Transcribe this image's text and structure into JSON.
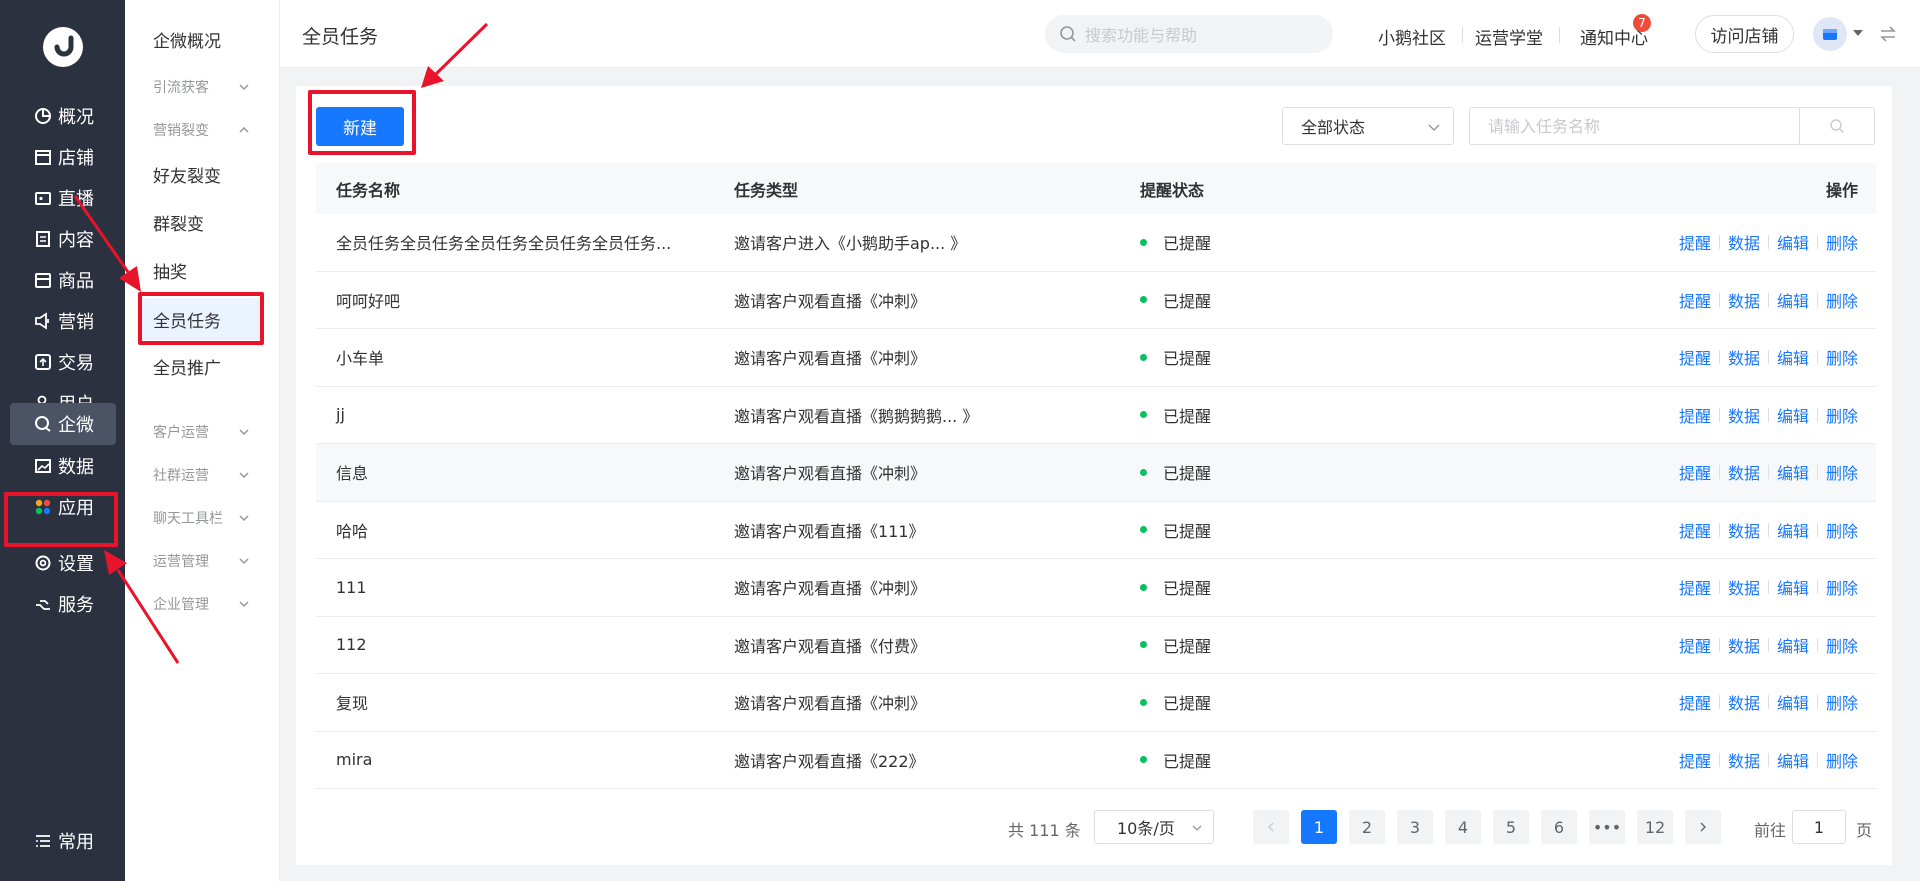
{
  "nav": {
    "items": [
      {
        "label": "概况",
        "icon": "pie-chart-icon"
      },
      {
        "label": "店铺",
        "icon": "store-icon"
      },
      {
        "label": "直播",
        "icon": "live-icon"
      },
      {
        "label": "内容",
        "icon": "document-icon"
      },
      {
        "label": "商品",
        "icon": "box-icon"
      },
      {
        "label": "营销",
        "icon": "megaphone-icon"
      },
      {
        "label": "交易",
        "icon": "trade-icon"
      },
      {
        "label": "用户",
        "icon": "user-icon"
      },
      {
        "label": "企微",
        "icon": "chat-icon"
      },
      {
        "label": "数据",
        "icon": "image-chart-icon"
      },
      {
        "label": "应用",
        "icon": "apps-icon"
      },
      {
        "label": "设置",
        "icon": "gear-icon"
      },
      {
        "label": "服务",
        "icon": "service-icon"
      },
      {
        "label": "常用",
        "icon": "list-icon"
      }
    ]
  },
  "subnav": {
    "overview": "企微概况",
    "group_lead": "引流获客",
    "group_fission": "营销裂变",
    "friend_fission": "好友裂变",
    "group_split": "群裂变",
    "lottery": "抽奖",
    "all_task": "全员任务",
    "all_promo": "全员推广",
    "customer_ops": "客户运营",
    "community_ops": "社群运营",
    "chat_toolbar": "聊天工具栏",
    "ops_mgmt": "运营管理",
    "enterprise_mgmt": "企业管理"
  },
  "header": {
    "title": "全员任务",
    "search_placeholder": "搜索功能与帮助",
    "community": "小鹅社区",
    "academy": "运营学堂",
    "notify": "通知中心",
    "notify_count": "7",
    "visit_store": "访问店铺"
  },
  "toolbar": {
    "new_label": "新建",
    "status_value": "全部状态",
    "name_placeholder": "请输入任务名称"
  },
  "table": {
    "headers": [
      "任务名称",
      "任务类型",
      "提醒状态",
      "操作"
    ],
    "actions": [
      "提醒",
      "数据",
      "编辑",
      "删除"
    ],
    "rows": [
      {
        "name": "全员任务全员任务全员任务全员任务全员任务...",
        "type": "邀请客户进入《小鹅助手ap... 》",
        "status": "已提醒"
      },
      {
        "name": "呵呵好吧",
        "type": "邀请客户观看直播《冲刺》",
        "status": "已提醒"
      },
      {
        "name": "小车单",
        "type": "邀请客户观看直播《冲刺》",
        "status": "已提醒"
      },
      {
        "name": "jj",
        "type": "邀请客户观看直播《鹅鹅鹅鹅... 》",
        "status": "已提醒"
      },
      {
        "name": "信息",
        "type": "邀请客户观看直播《冲刺》",
        "status": "已提醒"
      },
      {
        "name": "哈哈",
        "type": "邀请客户观看直播《111》",
        "status": "已提醒"
      },
      {
        "name": "111",
        "type": "邀请客户观看直播《冲刺》",
        "status": "已提醒"
      },
      {
        "name": "112",
        "type": "邀请客户观看直播《付费》",
        "status": "已提醒"
      },
      {
        "name": "复现",
        "type": "邀请客户观看直播《冲刺》",
        "status": "已提醒"
      },
      {
        "name": "mira",
        "type": "邀请客户观看直播《222》",
        "status": "已提醒"
      }
    ]
  },
  "pagination": {
    "total": "共 111 条",
    "page_size": "10条/页",
    "pages": [
      "1",
      "2",
      "3",
      "4",
      "5",
      "6",
      "•••",
      "12"
    ],
    "current": "1",
    "goto_prefix": "前往",
    "goto_value": "1",
    "goto_suffix": "页"
  },
  "colors": {
    "nav_bg": "#2b313f",
    "primary": "#1677ff",
    "status_dot": "#07c160",
    "annotation_red": "#e8142c"
  }
}
